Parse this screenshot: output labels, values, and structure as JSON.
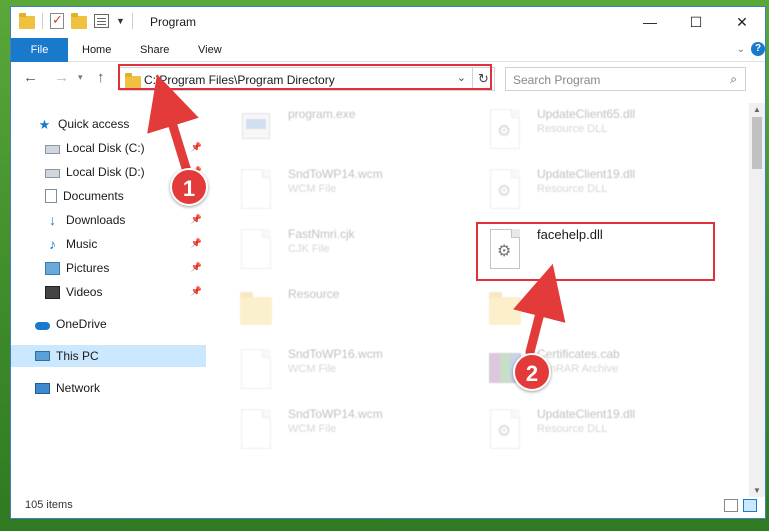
{
  "window": {
    "title": "Program"
  },
  "ribbon": {
    "tabs": [
      "File",
      "Home",
      "Share",
      "View"
    ]
  },
  "address": {
    "path": "C:\\Program Files\\Program Directory"
  },
  "search": {
    "placeholder": "Search Program"
  },
  "sidebar": {
    "items": [
      {
        "label": "Quick access",
        "icon": "star-icon"
      },
      {
        "label": "Local Disk (C:)",
        "icon": "drive-icon"
      },
      {
        "label": "Local Disk (D:)",
        "icon": "drive-icon"
      },
      {
        "label": "Documents",
        "icon": "documents-icon"
      },
      {
        "label": "Downloads",
        "icon": "downloads-icon"
      },
      {
        "label": "Music",
        "icon": "music-icon"
      },
      {
        "label": "Pictures",
        "icon": "pictures-icon"
      },
      {
        "label": "Videos",
        "icon": "videos-icon"
      },
      {
        "label": "OneDrive",
        "icon": "cloud-icon"
      },
      {
        "label": "This PC",
        "icon": "computer-icon"
      },
      {
        "label": "Network",
        "icon": "network-icon"
      }
    ]
  },
  "files": [
    {
      "name": "program.exe",
      "type": ""
    },
    {
      "name": "UpdateClient65.dll",
      "type": "Resource DLL"
    },
    {
      "name": "SndToWP14.wcm",
      "type": "WCM File"
    },
    {
      "name": "UpdateClient19.dll",
      "type": "Resource DLL"
    },
    {
      "name": "FastNmri.cjk",
      "type": "CJK File"
    },
    {
      "name": "facehelp.dll",
      "type": ""
    },
    {
      "name": "Resource",
      "type": ""
    },
    {
      "name": "SndToWP16.wcm",
      "type": "WCM File"
    },
    {
      "name": "Certificates.cab",
      "type": "WinRAR Archive"
    },
    {
      "name": "SndToWP14.wcm",
      "type": "WCM File"
    },
    {
      "name": "UpdateClient19.dll",
      "type": "Resource DLL"
    }
  ],
  "status": {
    "item_count": "105 items"
  },
  "annotations": {
    "step1": "1",
    "step2": "2"
  },
  "colors": {
    "accent": "#1979ca",
    "highlight": "#e0303a",
    "selected": "#cce8ff"
  }
}
